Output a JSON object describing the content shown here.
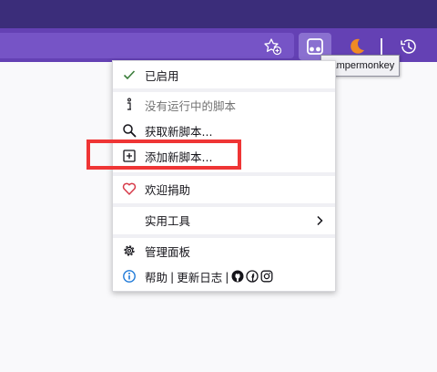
{
  "toolbar": {
    "star_icon": "bookmark-star-icon",
    "extension_icon": "tampermonkey-icon",
    "moon_icon": "theme-moon-icon",
    "history_icon": "history-icon"
  },
  "tooltip": {
    "text": "Tampermonkey"
  },
  "menu": {
    "enabled": "已启用",
    "no_scripts": "没有运行中的脚本",
    "get_scripts": "获取新脚本...",
    "add_script": "添加新脚本...",
    "donate": "欢迎捐助",
    "utilities": "实用工具",
    "dashboard": "管理面板",
    "help": "帮助",
    "changelog": "更新日志",
    "separator": "|"
  },
  "colors": {
    "titlebar": "#3b2d7a",
    "navbar": "#6441b4",
    "highlight": "#ef3535",
    "check": "#3a7d3a",
    "heart": "#d73a49",
    "info": "#1f7ad8"
  }
}
